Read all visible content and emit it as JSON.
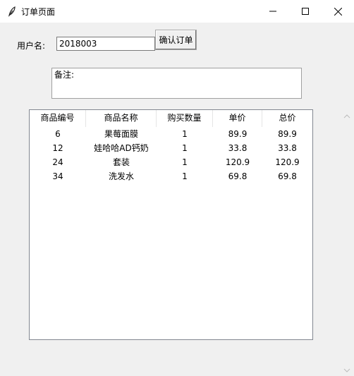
{
  "window": {
    "title": "订单页面",
    "icons": {
      "app": "feather-icon",
      "minimize": "minimize-icon",
      "maximize": "maximize-icon",
      "close": "close-icon"
    }
  },
  "form": {
    "username_label": "用户名:",
    "username_value": "2018003",
    "confirm_label": "确认订单",
    "note_value": "备注:"
  },
  "table": {
    "headers": [
      "商品编号",
      "商品名称",
      "购买数量",
      "单价",
      "总价"
    ],
    "rows": [
      [
        "6",
        "果莓面膜",
        "1",
        "89.9",
        "89.9"
      ],
      [
        "12",
        "娃哈哈AD钙奶",
        "1",
        "33.8",
        "33.8"
      ],
      [
        "24",
        "套装",
        "1",
        "120.9",
        "120.9"
      ],
      [
        "34",
        "洗发水",
        "1",
        "69.8",
        "69.8"
      ]
    ]
  }
}
